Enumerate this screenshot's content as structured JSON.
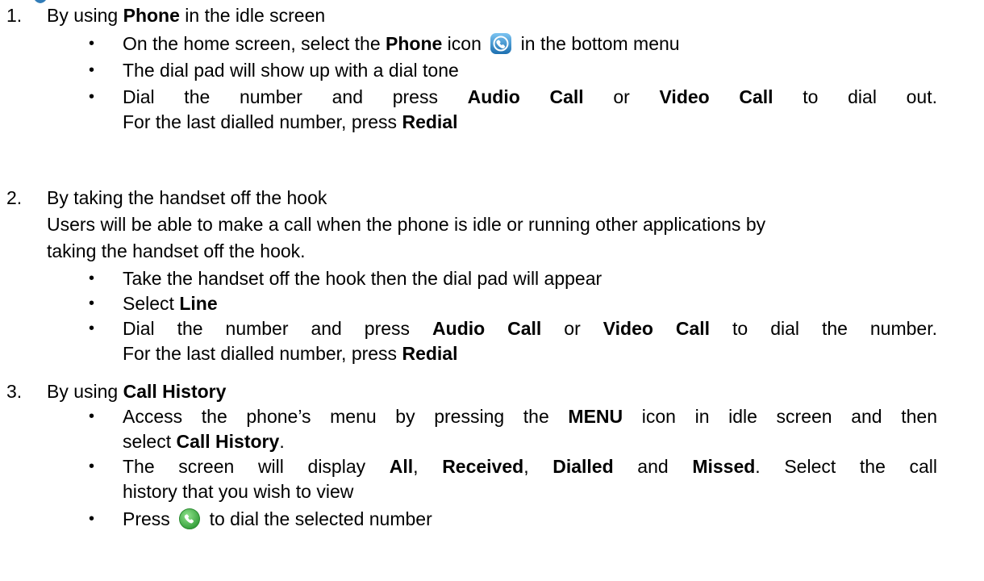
{
  "sections": [
    {
      "number": "1.",
      "heading": {
        "pre": "By using ",
        "bold": "Phone",
        "post": " in the idle screen"
      },
      "bullets": [
        {
          "pre": "On the home screen, select the ",
          "bold": "Phone",
          "mid": " icon",
          "post": " in the bottom menu",
          "icon": "phone-app-icon"
        },
        {
          "text": "The dial pad will show up with a dial tone"
        },
        {
          "l1_a": "Dial the number and press ",
          "l1_b": "Audio Call",
          "l1_c": " or ",
          "l1_d": "Video Call",
          "l1_e": " to dial out.",
          "l2_a": "For the last dialled number, press ",
          "l2_b": "Redial"
        }
      ]
    },
    {
      "number": "2.",
      "heading": {
        "text": "By taking the handset off the hook"
      },
      "intro": [
        "Users will be able to make a call when the phone is idle or running other applications by",
        "taking the handset off the hook."
      ],
      "bullets": [
        {
          "text": "Take the handset off the hook then the dial pad will appear"
        },
        {
          "pre": "Select ",
          "bold": "Line"
        },
        {
          "l1_a": "Dial the number and press ",
          "l1_b": "Audio Call",
          "l1_c": " or ",
          "l1_d": "Video Call",
          "l1_e": " to dial the number.",
          "l2_a": "For the last dialled number, press ",
          "l2_b": "Redial"
        }
      ]
    },
    {
      "number": "3.",
      "heading": {
        "pre": "By using ",
        "bold": "Call History"
      },
      "bullets": [
        {
          "l1_a": "Access the phone’s menu by pressing the ",
          "l1_b": "MENU",
          "l1_c": " icon in idle screen and then",
          "l2_a": "select ",
          "l2_b": "Call History",
          "l2_c": "."
        },
        {
          "l1_a": "The screen will display ",
          "l1_b": "All",
          "l1_c": ", ",
          "l1_d": "Received",
          "l1_e": ", ",
          "l1_f": "Dialled",
          "l1_g": " and ",
          "l1_h": "Missed",
          "l1_i": ". Select the call",
          "l2_a": "history that you wish to view"
        },
        {
          "pre": "Press",
          "post": " to dial the selected number",
          "icon": "green-call-icon"
        }
      ]
    }
  ],
  "bullet_glyph": "•",
  "colors": {
    "phone_icon_blue": "#2a82c8",
    "call_icon_green": "#3cb043"
  }
}
